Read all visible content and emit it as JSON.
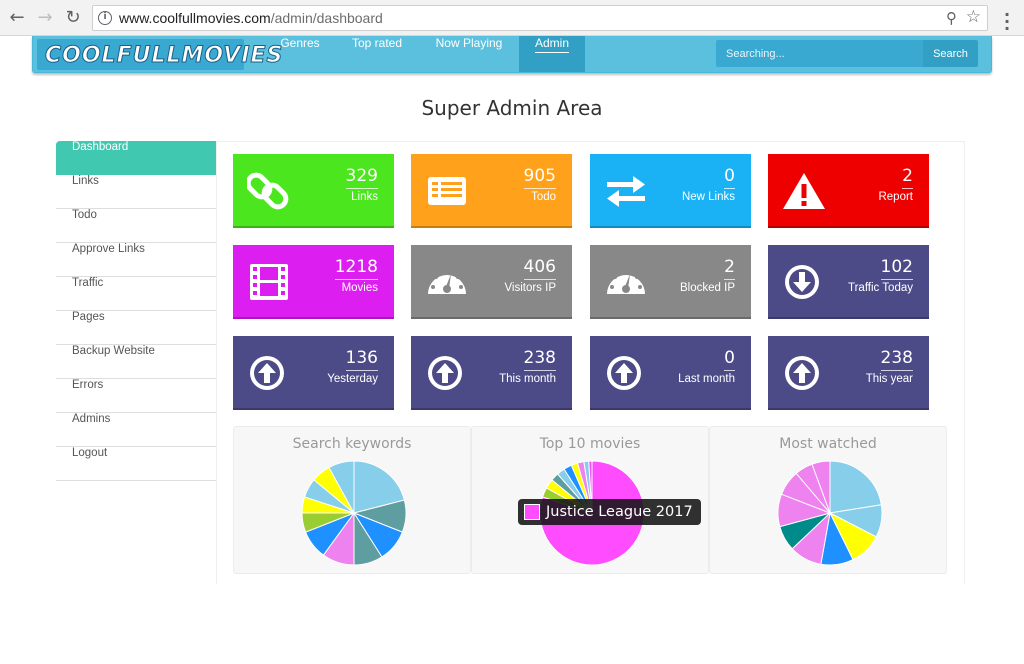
{
  "browser": {
    "url_host": "www.coolfullmovies.com",
    "url_path": "/admin/dashboard"
  },
  "site": {
    "logo": "COOLFULLMOVIES",
    "nav": [
      "Genres",
      "Top rated",
      "Now Playing",
      "Admin"
    ],
    "active_nav": "Admin",
    "search_placeholder": "Searching...",
    "search_button": "Search"
  },
  "page_title": "Super Admin Area",
  "sidebar": {
    "items": [
      {
        "label": "Dashboard"
      },
      {
        "label": "Links"
      },
      {
        "label": "Todo"
      },
      {
        "label": "Approve Links"
      },
      {
        "label": "Traffic"
      },
      {
        "label": "Pages"
      },
      {
        "label": "Backup Website"
      },
      {
        "label": "Errors"
      },
      {
        "label": "Admins"
      },
      {
        "label": "Logout"
      }
    ]
  },
  "tiles": [
    {
      "value": "329",
      "label": "Links",
      "color": "#4ce61e",
      "icon": "chain-link-icon"
    },
    {
      "value": "905",
      "label": "Todo",
      "color": "#ffa11a",
      "icon": "list-card-icon"
    },
    {
      "value": "0",
      "label": "New Links",
      "color": "#1ab2f5",
      "icon": "exchange-arrows-icon"
    },
    {
      "value": "2",
      "label": "Report",
      "color": "#ee0000",
      "icon": "warning-icon"
    },
    {
      "value": "1218",
      "label": "Movies",
      "color": "#dd1ef0",
      "icon": "film-icon"
    },
    {
      "value": "406",
      "label": "Visitors IP",
      "color": "#888888",
      "icon": "speedometer-icon"
    },
    {
      "value": "2",
      "label": "Blocked IP",
      "color": "#888888",
      "icon": "speedometer-icon"
    },
    {
      "value": "102",
      "label": "Traffic Today",
      "color": "#4d4a88",
      "icon": "arrow-down-circle-icon"
    },
    {
      "value": "136",
      "label": "Yesterday",
      "color": "#4d4a88",
      "icon": "arrow-up-circle-icon"
    },
    {
      "value": "238",
      "label": "This month",
      "color": "#4d4a88",
      "icon": "arrow-up-circle-icon"
    },
    {
      "value": "0",
      "label": "Last month",
      "color": "#4d4a88",
      "icon": "arrow-up-circle-icon"
    },
    {
      "value": "238",
      "label": "This year",
      "color": "#4d4a88",
      "icon": "arrow-up-circle-icon"
    }
  ],
  "chart_data": [
    {
      "type": "pie",
      "title": "Search keywords",
      "values": [
        21,
        10,
        10,
        9,
        10,
        9,
        6,
        5,
        6,
        6,
        8
      ],
      "colors": [
        "#87ceeb",
        "#5f9ea0",
        "#1e90ff",
        "#5f9ea0",
        "#ee82ee",
        "#1e90ff",
        "#9acd32",
        "#ffff00",
        "#87ceeb",
        "#ffff00",
        "#87ceeb"
      ]
    },
    {
      "type": "pie",
      "title": "Top 10 movies",
      "values": [
        80,
        3,
        3,
        2.5,
        2.5,
        2.5,
        2,
        2,
        1.5,
        1
      ],
      "colors": [
        "#ff4cff",
        "#9acd32",
        "#ffff00",
        "#5f9ea0",
        "#87ceeb",
        "#1e90ff",
        "#ffff00",
        "#ee82ee",
        "#87ceeb",
        "#ff4cff"
      ],
      "tooltip": {
        "label": "Justice League 2017",
        "color": "#ff4cff"
      }
    },
    {
      "type": "pie",
      "title": "Most watched",
      "values": [
        20,
        9,
        9,
        9,
        9,
        7,
        9,
        7,
        5,
        5
      ],
      "colors": [
        "#87ceeb",
        "#87ceeb",
        "#ffff00",
        "#1e90ff",
        "#ee82ee",
        "#008b8b",
        "#ee82ee",
        "#ee82ee",
        "#ee82ee",
        "#ee82ee"
      ]
    }
  ]
}
